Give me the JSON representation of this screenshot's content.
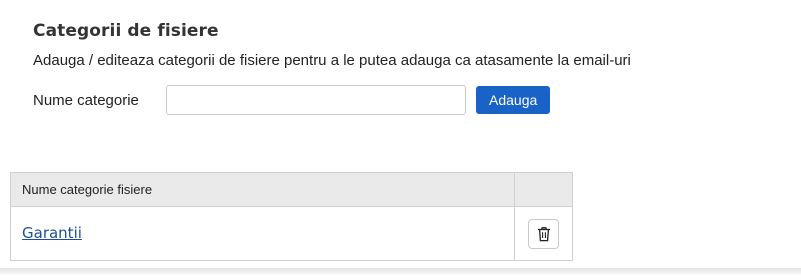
{
  "header": {
    "title": "Categorii de fisiere",
    "subtitle": "Adauga / editeaza categorii de fisiere pentru a le putea adauga ca atasamente la email-uri"
  },
  "form": {
    "label": "Nume categorie",
    "input_value": "",
    "input_placeholder": "",
    "add_button_label": "Adauga"
  },
  "table": {
    "columns": [
      "Nume categorie fisiere",
      ""
    ],
    "rows": [
      {
        "name": "Garantii",
        "action_icon": "trash-icon"
      }
    ]
  },
  "colors": {
    "primary_button": "#1a63c6",
    "link": "#1a4f9c",
    "table_header_bg": "#eaeaea"
  }
}
